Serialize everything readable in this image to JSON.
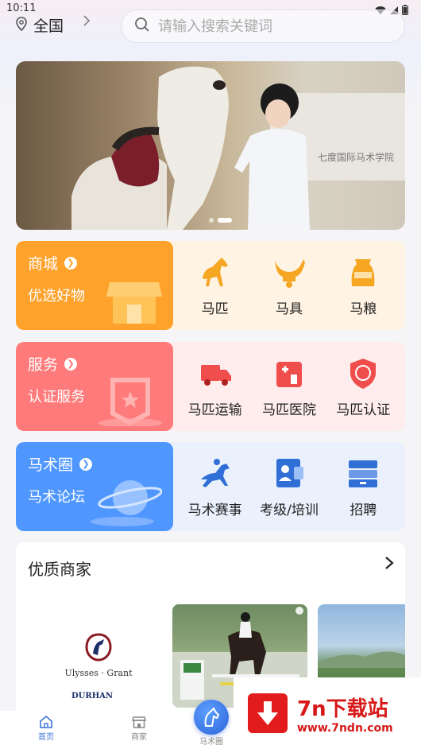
{
  "status": {
    "time": "10:11"
  },
  "header": {
    "location": "全国",
    "search_placeholder": "请输入搜索关键词"
  },
  "banner": {
    "wall_text": "七度国际马术学院",
    "slides": 2,
    "active_slide": 2
  },
  "categories": [
    {
      "title": "商城",
      "subtitle": "优选好物",
      "color": "#ffa22c",
      "bg": "#fff3e3",
      "items": [
        {
          "label": "马匹",
          "icon": "horse-icon"
        },
        {
          "label": "马具",
          "icon": "saddle-icon"
        },
        {
          "label": "马粮",
          "icon": "feed-bag-icon"
        }
      ]
    },
    {
      "title": "服务",
      "subtitle": "认证服务",
      "color": "#ff7a7a",
      "bg": "#ffeded",
      "items": [
        {
          "label": "马匹运输",
          "icon": "truck-icon"
        },
        {
          "label": "马匹医院",
          "icon": "hospital-icon"
        },
        {
          "label": "马匹认证",
          "icon": "certificate-icon"
        }
      ]
    },
    {
      "title": "马术圈",
      "subtitle": "马术论坛",
      "color": "#4f97ff",
      "bg": "#eaf1fd",
      "items": [
        {
          "label": "马术赛事",
          "icon": "race-horse-icon"
        },
        {
          "label": "考级/培训",
          "icon": "training-icon"
        },
        {
          "label": "招聘",
          "icon": "recruit-icon"
        }
      ]
    }
  ],
  "merchants": {
    "title": "优质商家",
    "logo1": "Ulysses · Grant",
    "logo2": "DURHAN"
  },
  "watermark": {
    "title": "7n下载站",
    "url": "www.7ndn.com"
  },
  "nav": {
    "home": "首页",
    "merchant": "商家",
    "equestrian": "马术圈"
  }
}
